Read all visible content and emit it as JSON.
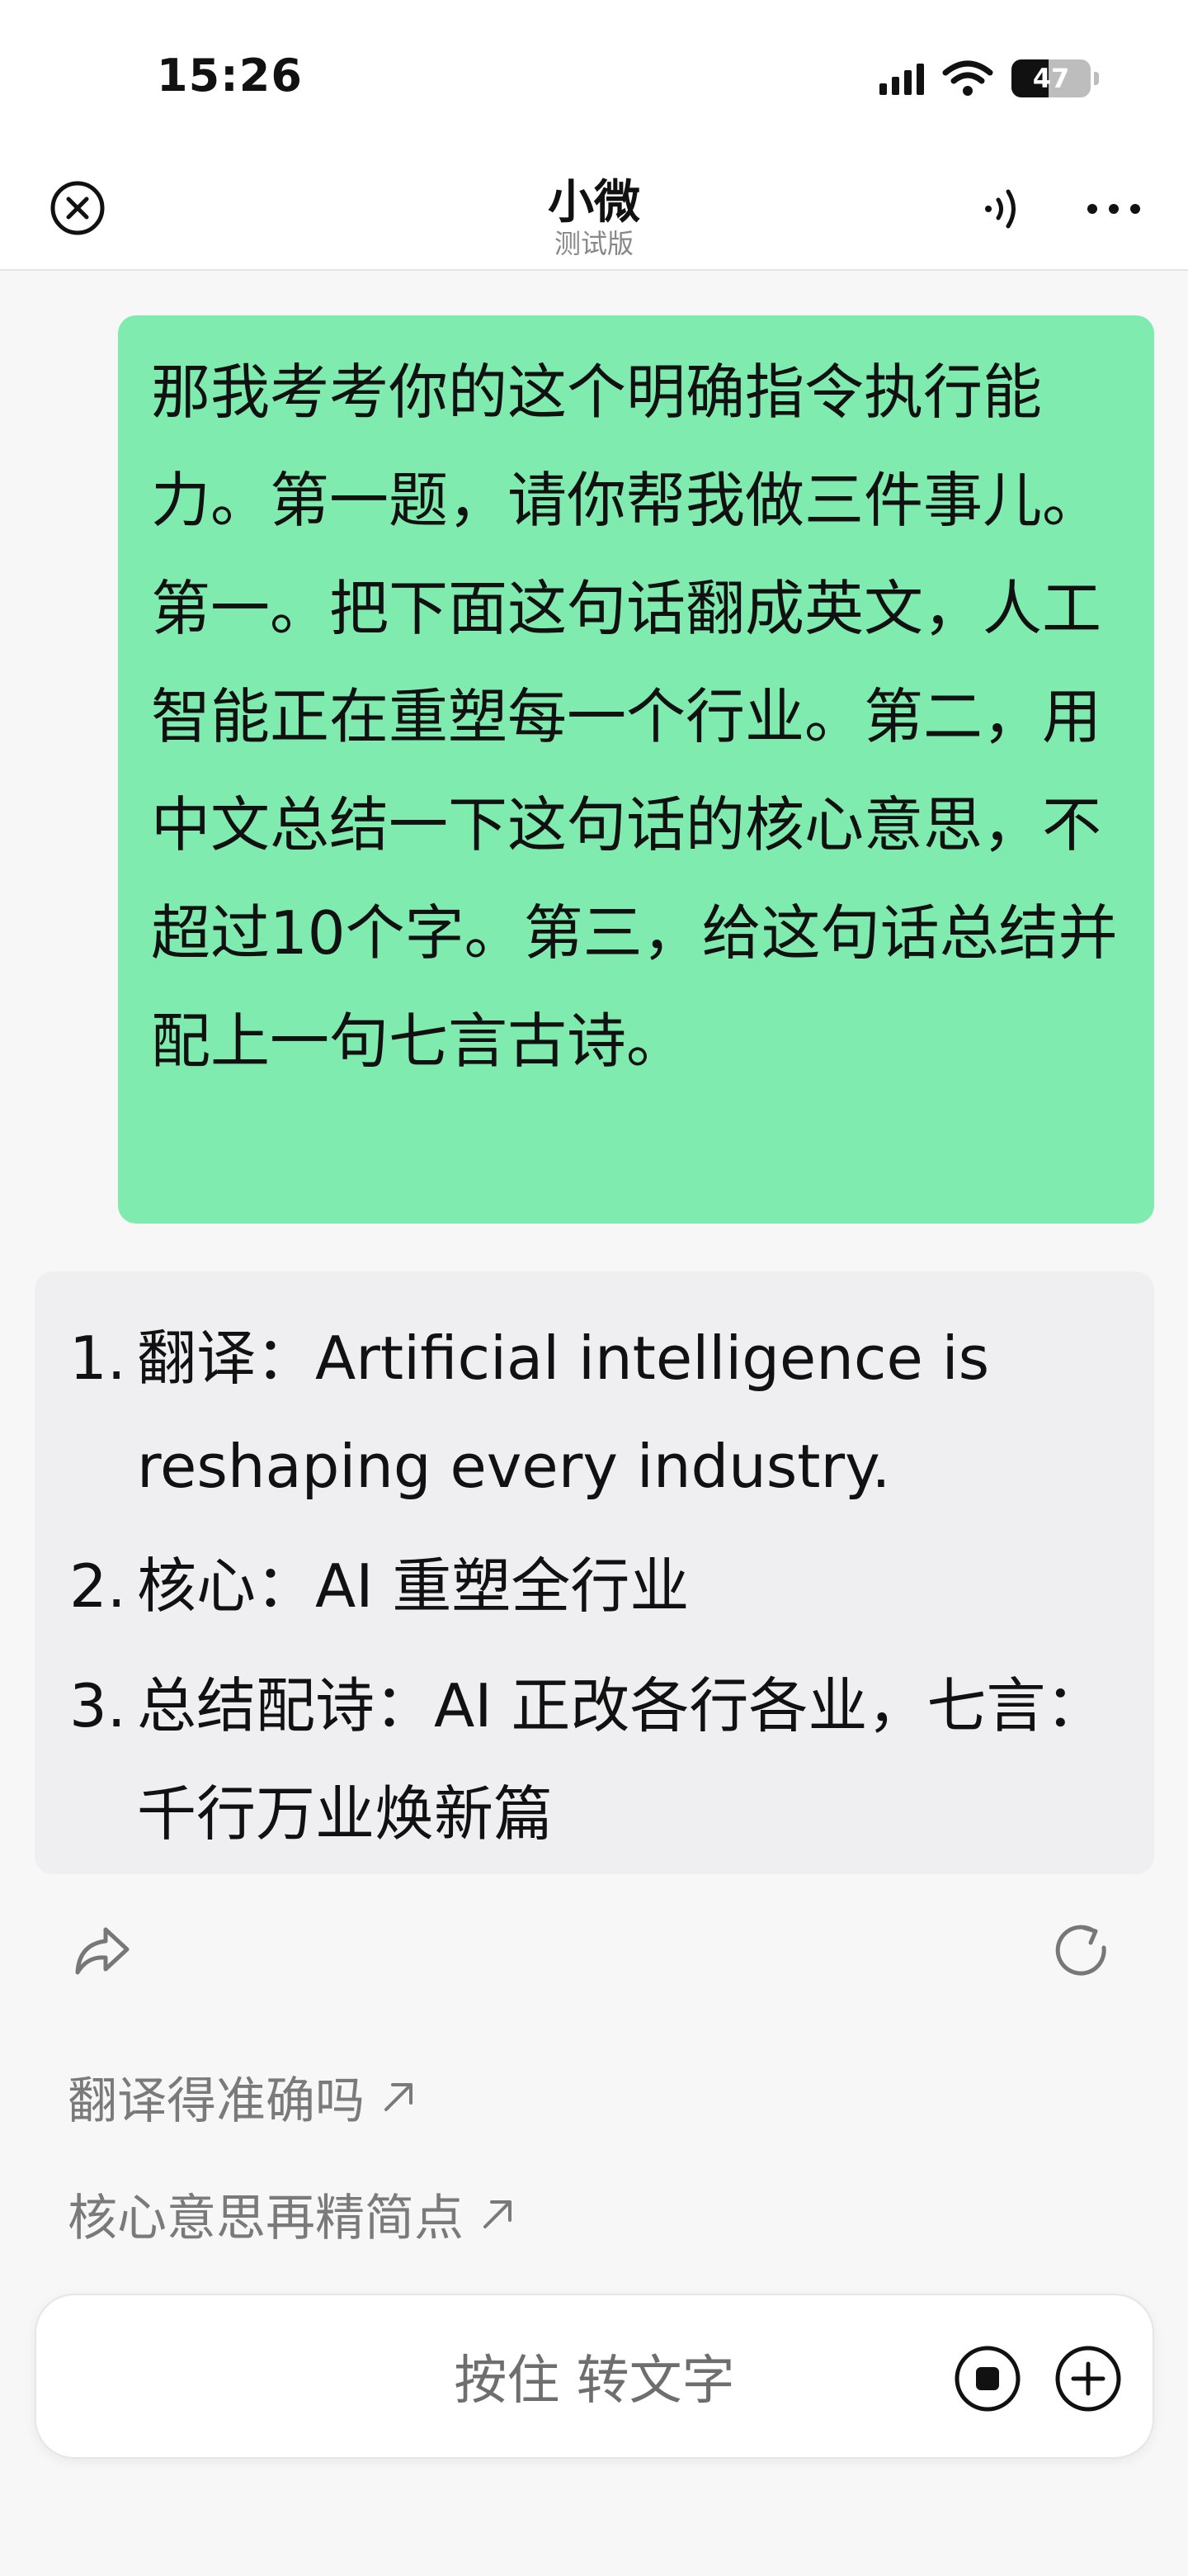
{
  "status_bar": {
    "time": "15:26",
    "battery_level": "47",
    "icons": [
      "signal-icon",
      "wifi-icon",
      "battery-icon"
    ]
  },
  "nav": {
    "title": "小微",
    "subtitle": "测试版",
    "icons": [
      "close-icon",
      "speaker-icon",
      "more-icon"
    ]
  },
  "chat": {
    "user_message": "那我考考你的这个明确指令执行能力。第一题，请你帮我做三件事儿。第一。把下面这句话翻成英文，人工智能正在重塑每一个行业。第二，用中文总结一下这句话的核心意思，不超过10个字。第三，给这句话总结并配上一句七言古诗。",
    "ai_reply": [
      {
        "num": "1.",
        "text": "翻译：Artificial intelligence is reshaping every industry."
      },
      {
        "num": "2.",
        "text": "核心：AI 重塑全行业"
      },
      {
        "num": "3.",
        "text": "总结配诗：AI 正改各行各业，七言：千行万业焕新篇"
      }
    ],
    "actions": [
      "share-icon",
      "refresh-icon"
    ]
  },
  "suggestions": [
    {
      "label": "翻译得准确吗"
    },
    {
      "label": "核心意思再精简点"
    }
  ],
  "input": {
    "placeholder": "按住 转文字"
  },
  "colors": {
    "user_bubble": "#80EBAE",
    "ai_bubble": "#EFEFF1",
    "background": "#F7F7F7",
    "suggestion_text": "#7A7A7A"
  }
}
